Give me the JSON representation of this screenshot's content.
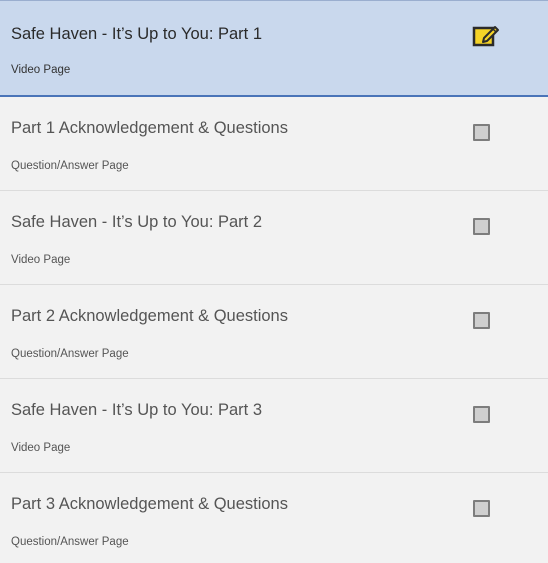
{
  "lessons": [
    {
      "title": "Safe Haven - It’s Up to You: Part 1",
      "type": "Video Page",
      "status": "in-progress",
      "icon": "edit-icon",
      "active": true
    },
    {
      "title": "Part 1 Acknowledgement & Questions",
      "type": "Question/Answer Page",
      "status": "not-started",
      "icon": "checkbox-icon",
      "active": false
    },
    {
      "title": "Safe Haven - It’s Up to You: Part 2",
      "type": "Video Page",
      "status": "not-started",
      "icon": "checkbox-icon",
      "active": false
    },
    {
      "title": "Part 2 Acknowledgement & Questions",
      "type": "Question/Answer Page",
      "status": "not-started",
      "icon": "checkbox-icon",
      "active": false
    },
    {
      "title": "Safe Haven - It’s Up to You: Part 3",
      "type": "Video Page",
      "status": "not-started",
      "icon": "checkbox-icon",
      "active": false
    },
    {
      "title": "Part 3 Acknowledgement & Questions",
      "type": "Question/Answer Page",
      "status": "not-started",
      "icon": "checkbox-icon",
      "active": false
    }
  ],
  "colors": {
    "active_background": "#c9d8ed",
    "active_border": "#4a74b8",
    "item_background": "#f2f2f2",
    "edit_icon_fill": "#f5d327",
    "checkbox_fill": "#cfcfcf"
  }
}
